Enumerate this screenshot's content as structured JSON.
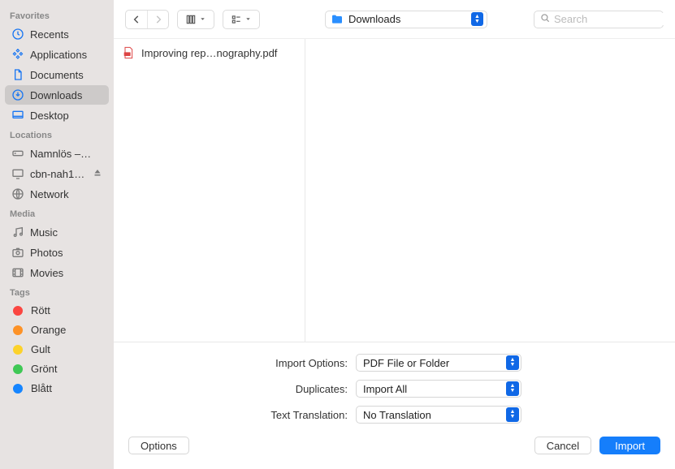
{
  "sidebar": {
    "sections": [
      {
        "title": "Favorites",
        "items": [
          {
            "icon": "clock",
            "label": "Recents",
            "selected": false,
            "kind": "fav"
          },
          {
            "icon": "apps",
            "label": "Applications",
            "selected": false,
            "kind": "fav"
          },
          {
            "icon": "doc",
            "label": "Documents",
            "selected": false,
            "kind": "fav"
          },
          {
            "icon": "download",
            "label": "Downloads",
            "selected": true,
            "kind": "fav"
          },
          {
            "icon": "desktop",
            "label": "Desktop",
            "selected": false,
            "kind": "fav"
          }
        ]
      },
      {
        "title": "Locations",
        "items": [
          {
            "icon": "disk",
            "label": "Namnlös –…",
            "kind": "location"
          },
          {
            "icon": "display",
            "label": "cbn-nah1…",
            "kind": "location",
            "eject": true
          },
          {
            "icon": "globe",
            "label": "Network",
            "kind": "location"
          }
        ]
      },
      {
        "title": "Media",
        "items": [
          {
            "icon": "music",
            "label": "Music",
            "kind": "media"
          },
          {
            "icon": "camera",
            "label": "Photos",
            "kind": "media"
          },
          {
            "icon": "movie",
            "label": "Movies",
            "kind": "media"
          }
        ]
      },
      {
        "title": "Tags",
        "items": [
          {
            "color": "#fb4641",
            "label": "Rött",
            "kind": "tag"
          },
          {
            "color": "#fd9226",
            "label": "Orange",
            "kind": "tag"
          },
          {
            "color": "#fcd22b",
            "label": "Gult",
            "kind": "tag"
          },
          {
            "color": "#3fc855",
            "label": "Grönt",
            "kind": "tag"
          },
          {
            "color": "#1685ff",
            "label": "Blått",
            "kind": "tag"
          }
        ]
      }
    ]
  },
  "toolbar": {
    "location_label": "Downloads",
    "search_placeholder": "Search"
  },
  "files": [
    {
      "type": "pdf",
      "name": "Improving rep…nography.pdf"
    }
  ],
  "options": {
    "rows": [
      {
        "label": "Import Options:",
        "value": "PDF File or Folder"
      },
      {
        "label": "Duplicates:",
        "value": "Import All"
      },
      {
        "label": "Text Translation:",
        "value": "No Translation"
      }
    ]
  },
  "footer": {
    "options": "Options",
    "cancel": "Cancel",
    "import": "Import"
  }
}
